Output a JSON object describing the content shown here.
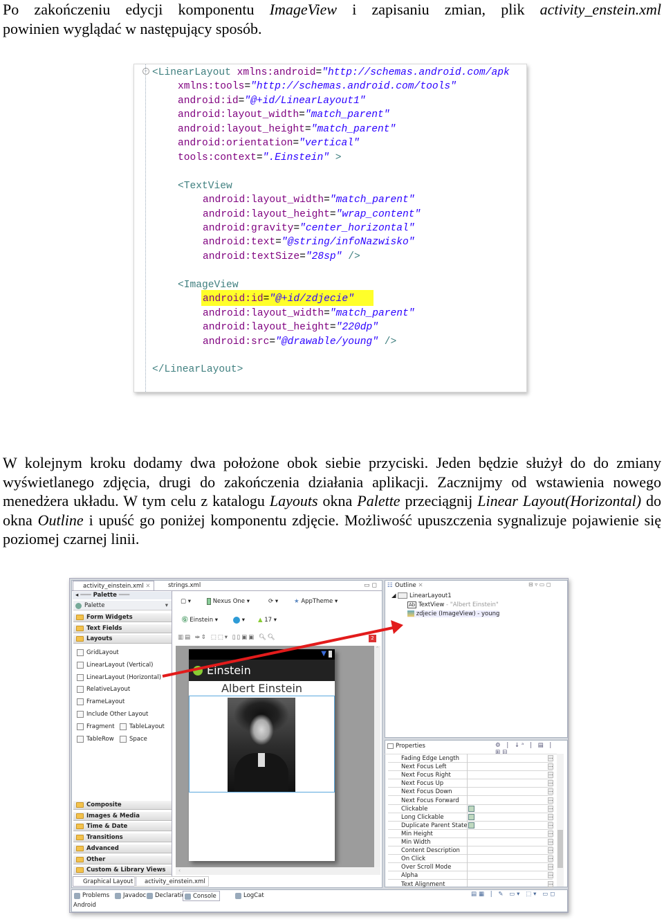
{
  "intro": {
    "parts": [
      "Po zakończeniu edycji komponentu ",
      "ImageView",
      " i zapisaniu zmian, plik ",
      "activity_enstein.xml",
      "powinien wyglądać w następujący sposób."
    ]
  },
  "code": {
    "colors": {
      "tag": "#3f7f7f",
      "attr": "#7f007f",
      "value": "#2a00ff",
      "highlight": "#ffff2a"
    },
    "lines": [
      {
        "indent": 0,
        "tokens": [
          [
            "tag",
            "<LinearLayout "
          ],
          [
            "attr",
            "xmlns:android"
          ],
          [
            "pl",
            "="
          ],
          [
            "val",
            "\"http://schemas.android.com/apk"
          ]
        ]
      },
      {
        "indent": 1,
        "tokens": [
          [
            "attr",
            "xmlns:tools"
          ],
          [
            "pl",
            "="
          ],
          [
            "val",
            "\"http://schemas.android.com/tools\""
          ]
        ]
      },
      {
        "indent": 1,
        "tokens": [
          [
            "attr",
            "android:id"
          ],
          [
            "pl",
            "="
          ],
          [
            "val",
            "\"@+id/LinearLayout1\""
          ]
        ]
      },
      {
        "indent": 1,
        "tokens": [
          [
            "attr",
            "android:layout_width"
          ],
          [
            "pl",
            "="
          ],
          [
            "val",
            "\"match_parent\""
          ]
        ]
      },
      {
        "indent": 1,
        "tokens": [
          [
            "attr",
            "android:layout_height"
          ],
          [
            "pl",
            "="
          ],
          [
            "val",
            "\"match_parent\""
          ]
        ]
      },
      {
        "indent": 1,
        "tokens": [
          [
            "attr",
            "android:orientation"
          ],
          [
            "pl",
            "="
          ],
          [
            "val",
            "\"vertical\""
          ]
        ]
      },
      {
        "indent": 1,
        "tokens": [
          [
            "attr",
            "tools:context"
          ],
          [
            "pl",
            "="
          ],
          [
            "val",
            "\".Einstein\""
          ],
          [
            "tag",
            " >"
          ]
        ]
      },
      {
        "indent": 0,
        "tokens": []
      },
      {
        "indent": 1,
        "tokens": [
          [
            "tag",
            "<TextView"
          ]
        ]
      },
      {
        "indent": 2,
        "tokens": [
          [
            "attr",
            "android:layout_width"
          ],
          [
            "pl",
            "="
          ],
          [
            "val",
            "\"match_parent\""
          ]
        ]
      },
      {
        "indent": 2,
        "tokens": [
          [
            "attr",
            "android:layout_height"
          ],
          [
            "pl",
            "="
          ],
          [
            "val",
            "\"wrap_content\""
          ]
        ]
      },
      {
        "indent": 2,
        "tokens": [
          [
            "attr",
            "android:gravity"
          ],
          [
            "pl",
            "="
          ],
          [
            "val",
            "\"center_horizontal\""
          ]
        ]
      },
      {
        "indent": 2,
        "tokens": [
          [
            "attr",
            "android:text"
          ],
          [
            "pl",
            "="
          ],
          [
            "val",
            "\"@string/infoNazwisko\""
          ]
        ]
      },
      {
        "indent": 2,
        "tokens": [
          [
            "attr",
            "android:textSize"
          ],
          [
            "pl",
            "="
          ],
          [
            "val",
            "\"28sp\""
          ],
          [
            "tag",
            " />"
          ]
        ]
      },
      {
        "indent": 0,
        "tokens": []
      },
      {
        "indent": 1,
        "tokens": [
          [
            "tag",
            "<ImageView"
          ]
        ]
      },
      {
        "indent": 2,
        "tokens": [
          [
            "attr",
            "android:id"
          ],
          [
            "pl",
            "="
          ],
          [
            "val",
            "\"@+id/zdjecie\""
          ]
        ]
      },
      {
        "indent": 2,
        "tokens": [
          [
            "attr",
            "android:layout_width"
          ],
          [
            "pl",
            "="
          ],
          [
            "val",
            "\"match_parent\""
          ]
        ]
      },
      {
        "indent": 2,
        "tokens": [
          [
            "attr",
            "android:layout_height"
          ],
          [
            "pl",
            "="
          ],
          [
            "val",
            "\"220dp\""
          ]
        ]
      },
      {
        "indent": 2,
        "tokens": [
          [
            "attr",
            "android:src"
          ],
          [
            "pl",
            "="
          ],
          [
            "val",
            "\"@drawable/young\""
          ],
          [
            "tag",
            " />"
          ]
        ]
      },
      {
        "indent": 0,
        "tokens": []
      },
      {
        "indent": 0,
        "tokens": [
          [
            "tag",
            "</LinearLayout>"
          ]
        ]
      }
    ]
  },
  "body": {
    "parts": [
      "W kolejnym kroku dodamy dwa położone obok siebie przyciski. Jeden będzie służył do do zmiany wyświetlanego zdjęcia, drugi do zakończenia działania aplikacji. Zacznijmy od wstawienia nowego menedżera układu. W tym celu z katalogu ",
      "Layouts",
      " okna ",
      "Palette",
      " przeciągnij ",
      "Linear Layout(Horizontal)",
      " do okna ",
      "Outline",
      " i upuść go poniżej komponentu zdjęcie. Możliwość upuszczenia sygnalizuje pojawienie się poziomej czarnej linii."
    ]
  },
  "ide": {
    "editor_tabs": [
      "activity_einstein.xml",
      "strings.xml"
    ],
    "palette": {
      "title": "Palette",
      "dropdown": "Palette",
      "top_categories": [
        "Form Widgets",
        "Text Fields",
        "Layouts"
      ],
      "layout_items": [
        "GridLayout",
        "LinearLayout (Vertical)",
        "LinearLayout (Horizontal)",
        "RelativeLayout",
        "FrameLayout",
        "Include Other Layout",
        "Fragment",
        "TableLayout",
        "TableRow",
        "Space"
      ],
      "bottom_categories": [
        "Composite",
        "Images & Media",
        "Time & Date",
        "Transitions",
        "Advanced",
        "Other",
        "Custom & Library Views"
      ]
    },
    "toolbar": {
      "device": "Nexus One",
      "theme": "AppTheme",
      "activity": "Einstein",
      "api": "17",
      "error_count": "2"
    },
    "preview": {
      "app_title": "Einstein",
      "text": "Albert Einstein"
    },
    "bottom_tabs": [
      "Graphical Layout",
      "activity_einstein.xml"
    ],
    "console_tabs": [
      "Problems",
      "Javadoc",
      "Declaration",
      "Console",
      "LogCat"
    ],
    "console_text": "Android",
    "outline": {
      "title": "Outline",
      "root": "LinearLayout1",
      "children": [
        {
          "name": "TextView",
          "detail": " - \"Albert Einstein\""
        },
        {
          "name": "zdjecie (ImageView) - young",
          "detail": ""
        }
      ]
    },
    "properties": {
      "title": "Properties",
      "rows": [
        {
          "name": "Fading Edge Length",
          "checkbox": false
        },
        {
          "name": "Next Focus Left",
          "checkbox": false
        },
        {
          "name": "Next Focus Right",
          "checkbox": false
        },
        {
          "name": "Next Focus Up",
          "checkbox": false
        },
        {
          "name": "Next Focus Down",
          "checkbox": false
        },
        {
          "name": "Next Focus Forward",
          "checkbox": false
        },
        {
          "name": "Clickable",
          "checkbox": true
        },
        {
          "name": "Long Clickable",
          "checkbox": true
        },
        {
          "name": "Duplicate Parent State",
          "checkbox": true
        },
        {
          "name": "Min Height",
          "checkbox": false
        },
        {
          "name": "Min Width",
          "checkbox": false
        },
        {
          "name": "Content Description",
          "checkbox": false
        },
        {
          "name": "On Click",
          "checkbox": false
        },
        {
          "name": "Over Scroll Mode",
          "checkbox": false
        },
        {
          "name": "Alpha",
          "checkbox": false
        },
        {
          "name": "Text Alignment",
          "checkbox": false
        }
      ]
    },
    "arrow_color": "#e21b1b"
  }
}
